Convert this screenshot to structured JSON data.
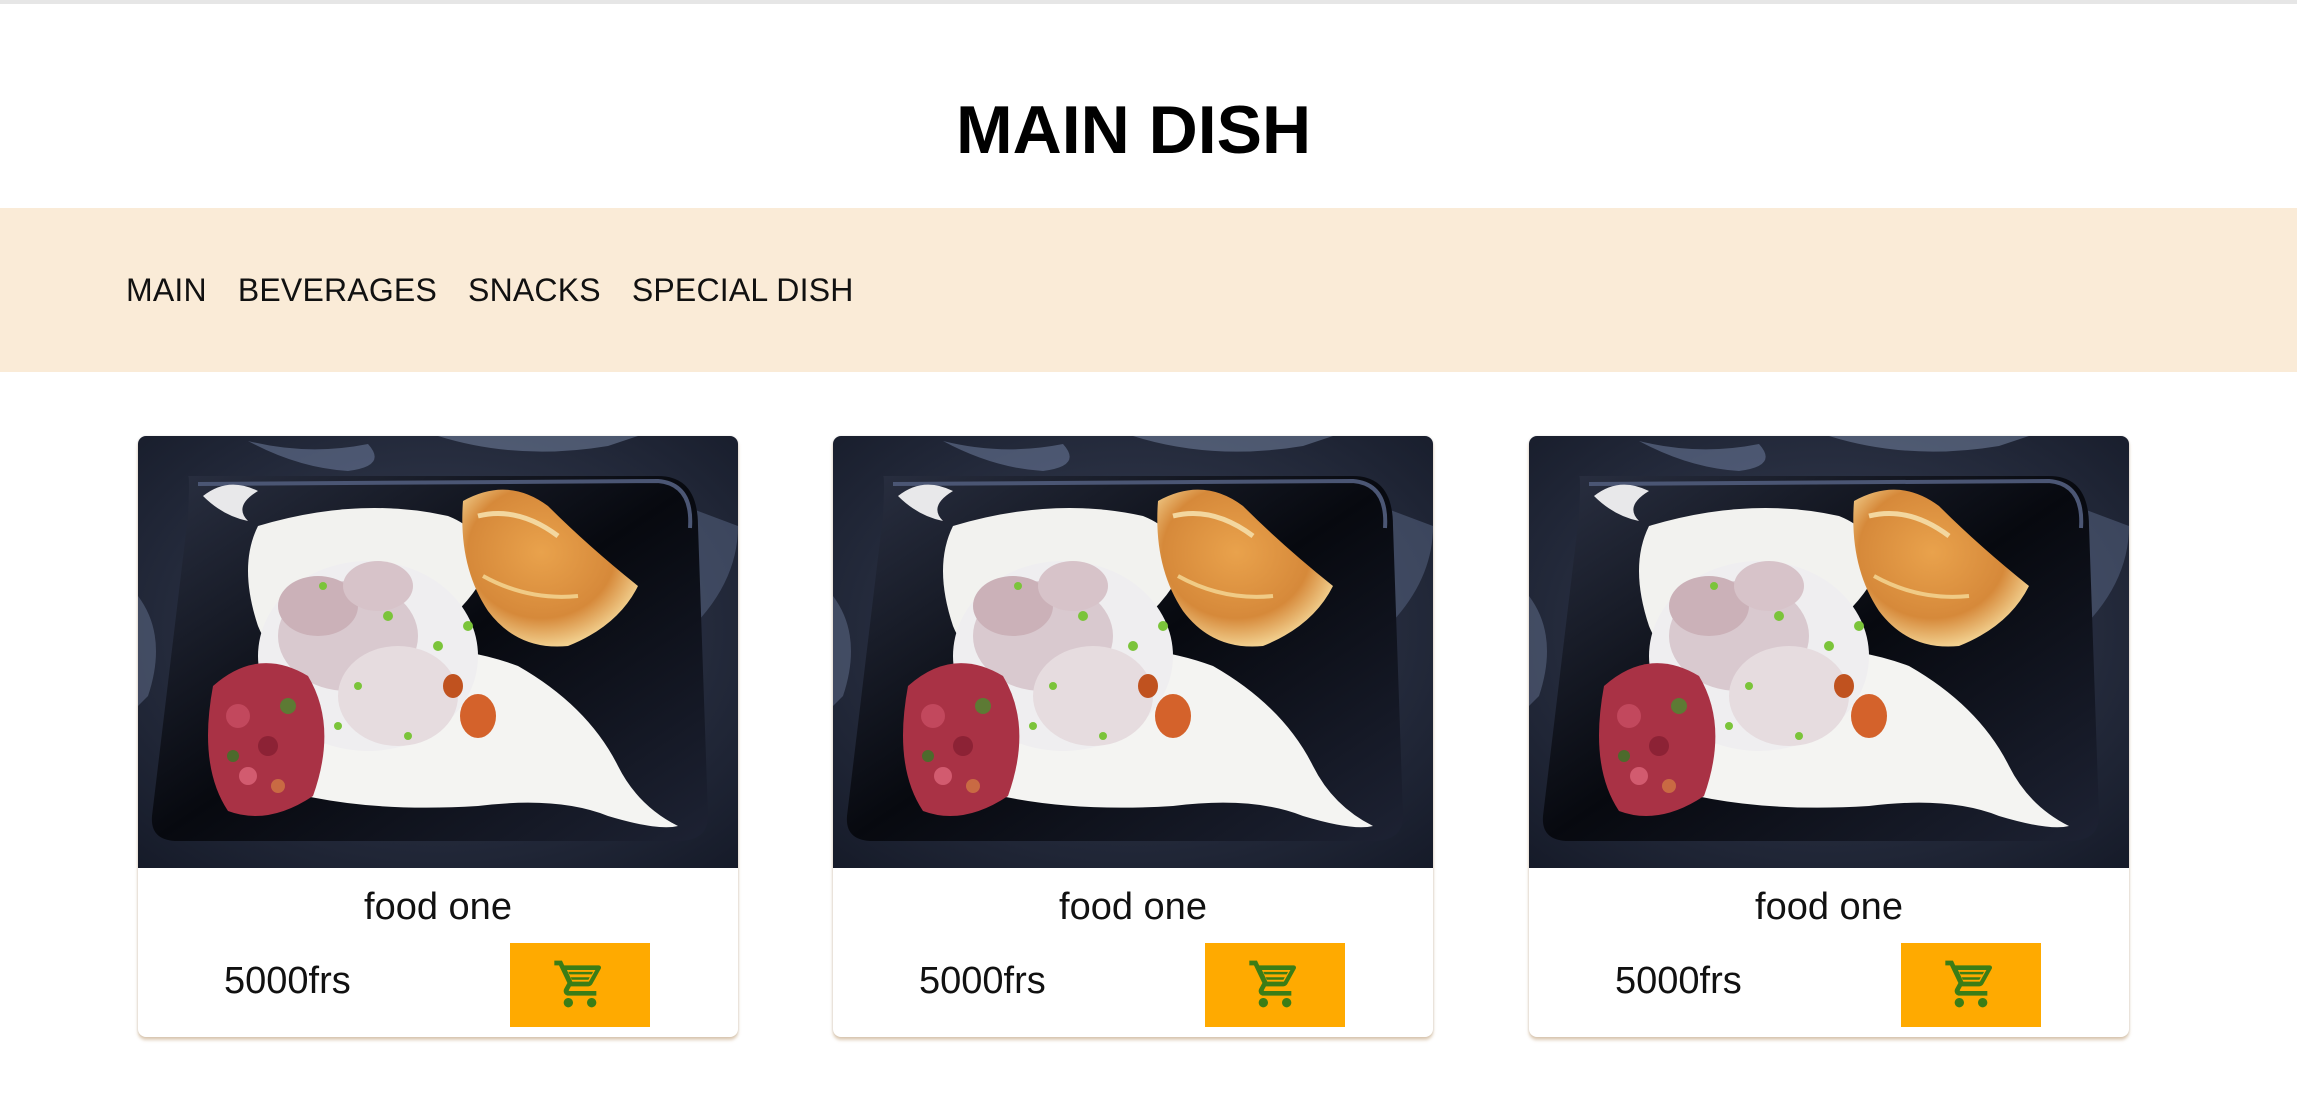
{
  "page": {
    "title": "MAIN DISH"
  },
  "nav": {
    "items": [
      {
        "label": "MAIN"
      },
      {
        "label": "BEVERAGES"
      },
      {
        "label": "SNACKS"
      },
      {
        "label": "SPECIAL DISH"
      }
    ],
    "background_color": "#faebd7"
  },
  "products": [
    {
      "name": "food one",
      "price": "5000frs",
      "cart_icon": "cart-icon"
    },
    {
      "name": "food one",
      "price": "5000frs",
      "cart_icon": "cart-icon"
    },
    {
      "name": "food one",
      "price": "5000frs",
      "cart_icon": "cart-icon"
    }
  ],
  "colors": {
    "cart_button": "#ffaa00",
    "cart_icon": "#3b7d16"
  }
}
